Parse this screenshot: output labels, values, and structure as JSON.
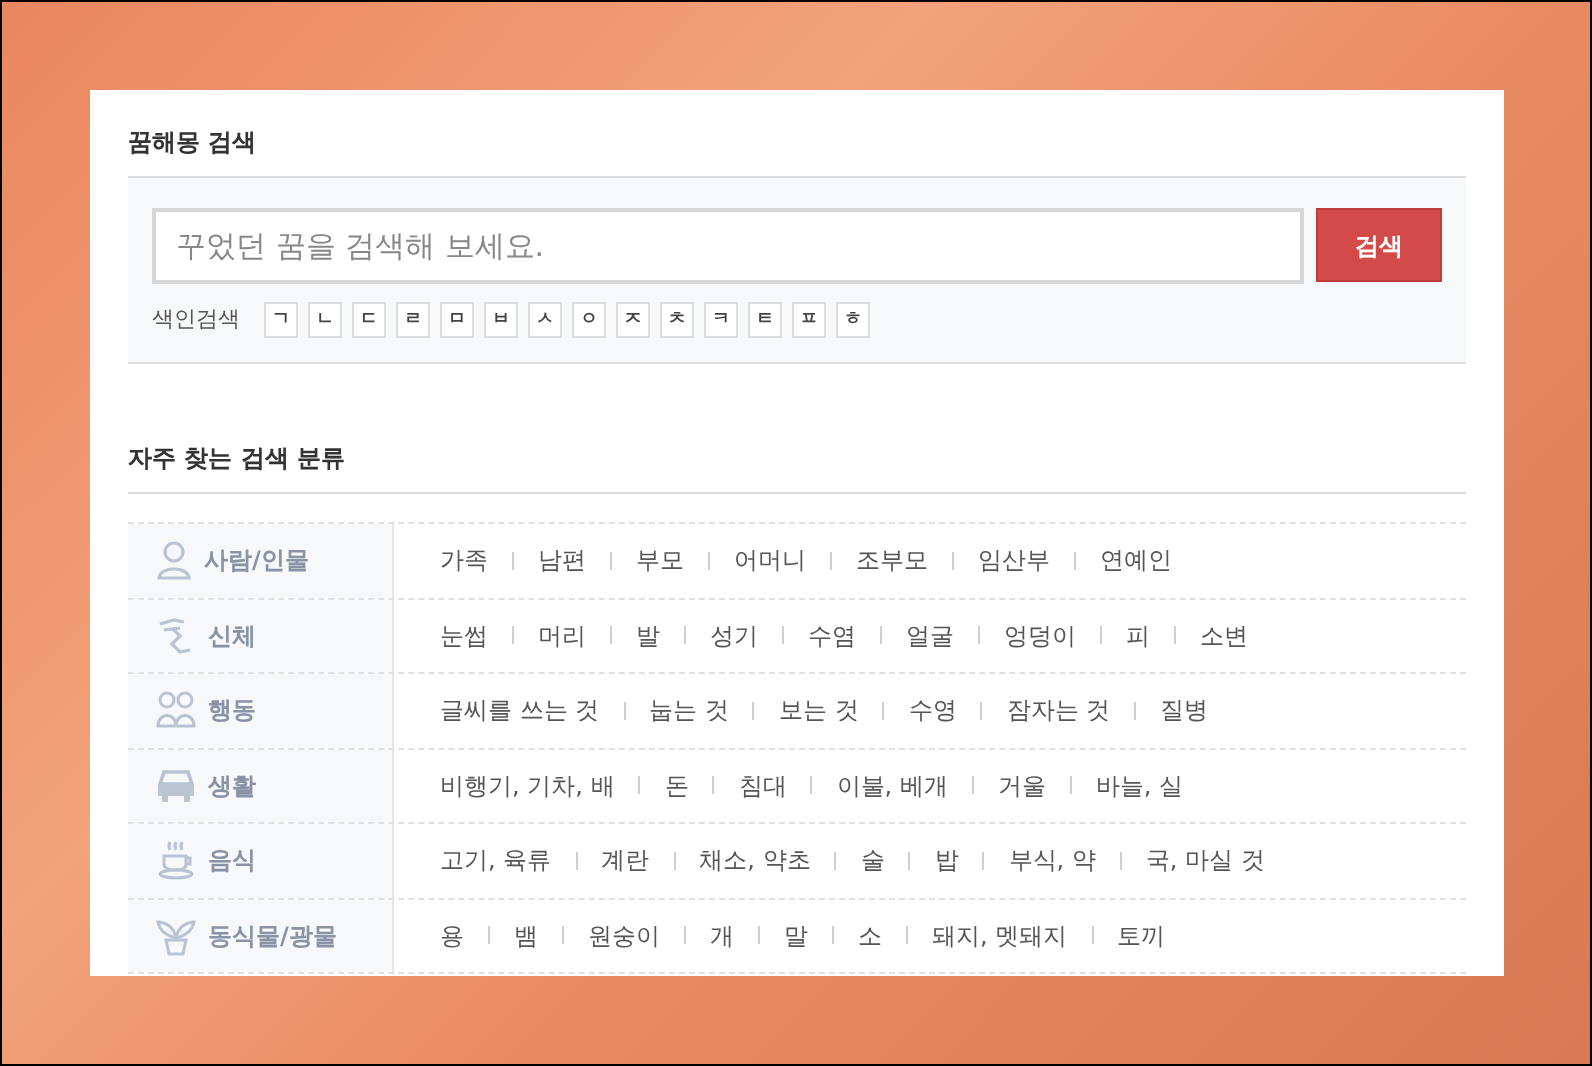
{
  "search_section": {
    "title": "꿈해몽 검색",
    "placeholder": "꾸었던 꿈을 검색해 보세요.",
    "button": "검색",
    "index_label": "색인검색",
    "index_keys": [
      "ㄱ",
      "ㄴ",
      "ㄷ",
      "ㄹ",
      "ㅁ",
      "ㅂ",
      "ㅅ",
      "ㅇ",
      "ㅈ",
      "ㅊ",
      "ㅋ",
      "ㅌ",
      "ㅍ",
      "ㅎ"
    ]
  },
  "categories_section": {
    "title": "자주 찾는 검색 분류",
    "categories": [
      {
        "kind": "person",
        "name": "사람/인물",
        "items": [
          "가족",
          "남편",
          "부모",
          "어머니",
          "조부모",
          "임산부",
          "연예인"
        ]
      },
      {
        "kind": "body",
        "name": "신체",
        "items": [
          "눈썹",
          "머리",
          "발",
          "성기",
          "수염",
          "얼굴",
          "엉덩이",
          "피",
          "소변"
        ]
      },
      {
        "kind": "action",
        "name": "행동",
        "items": [
          "글씨를 쓰는 것",
          "눕는 것",
          "보는 것",
          "수영",
          "잠자는 것",
          "질병"
        ]
      },
      {
        "kind": "life",
        "name": "생활",
        "items": [
          "비행기, 기차, 배",
          "돈",
          "침대",
          "이불, 베개",
          "거울",
          "바늘, 실"
        ]
      },
      {
        "kind": "food",
        "name": "음식",
        "items": [
          "고기, 육류",
          "계란",
          "채소, 약초",
          "술",
          "밥",
          "부식, 약",
          "국, 마실 것"
        ]
      },
      {
        "kind": "nature",
        "name": "동식물/광물",
        "items": [
          "용",
          "뱀",
          "원숭이",
          "개",
          "말",
          "소",
          "돼지, 멧돼지",
          "토끼"
        ]
      }
    ]
  }
}
